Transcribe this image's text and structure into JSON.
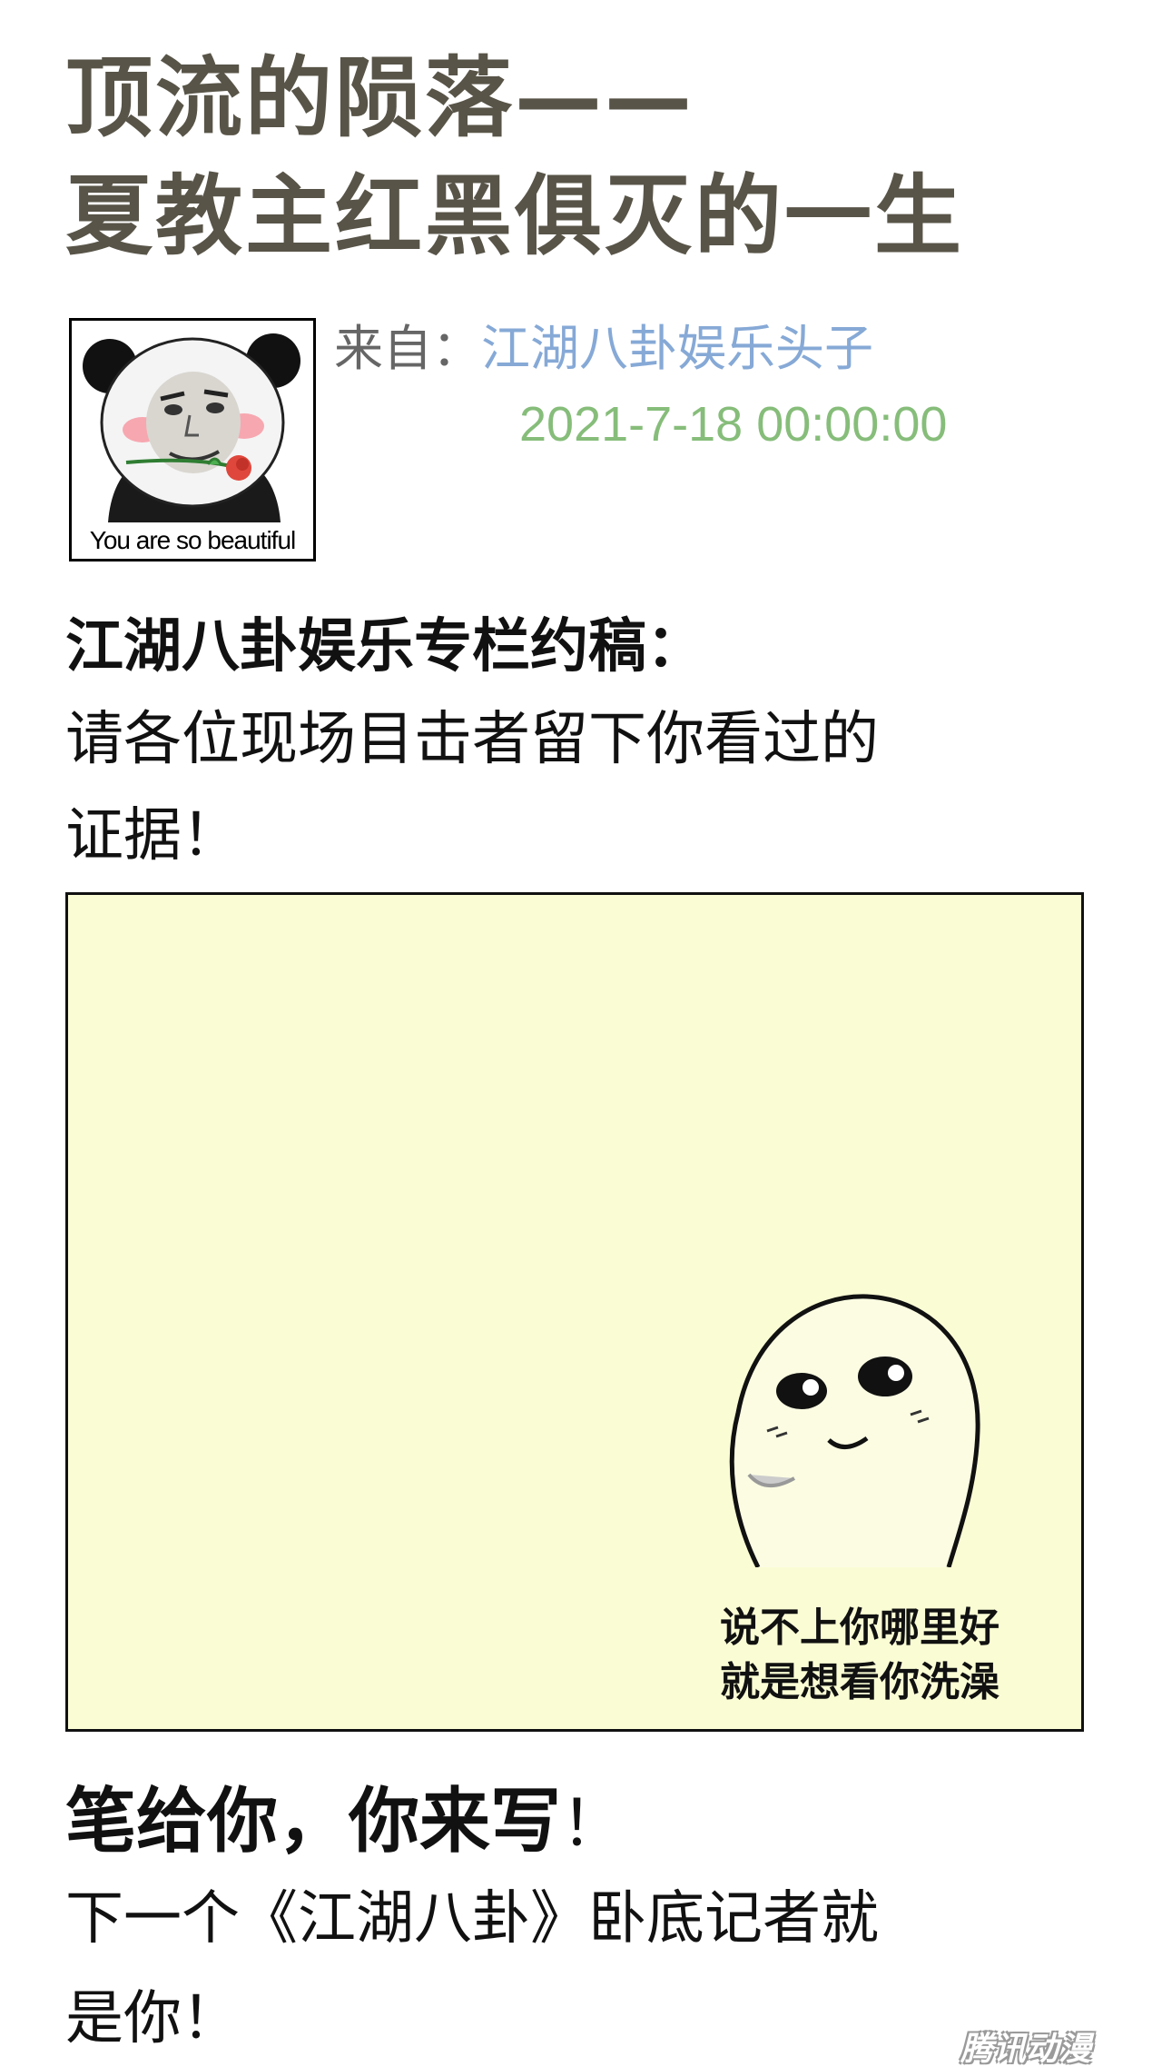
{
  "title": {
    "line1": "顶流的陨落——",
    "line2": "夏教主红黑俱灭的一生"
  },
  "meta": {
    "from_label": "来自：",
    "source": "江湖八卦娱乐头子",
    "datetime": "2021-7-18  00:00:00"
  },
  "avatar": {
    "caption": "You are so beautiful",
    "icon": "panda-meme-icon"
  },
  "section": {
    "heading": "江湖八卦娱乐专栏约稿：",
    "line1": "请各位现场目击者留下你看过的",
    "line2": "证据！"
  },
  "card": {
    "background": "#fafdd4",
    "meme_icon": "smiling-blob-icon",
    "caption_line1": "说不上你哪里好",
    "caption_line2": "就是想看你洗澡"
  },
  "cta": {
    "heading": "笔给你，你来写",
    "heading_exclaim": "！",
    "line1": "下一个《江湖八卦》卧底记者就",
    "line2": "是你！"
  },
  "watermark": "腾讯动漫",
  "colors": {
    "title": "#585448",
    "source": "#86a9d6",
    "datetime": "#86bd7a"
  }
}
